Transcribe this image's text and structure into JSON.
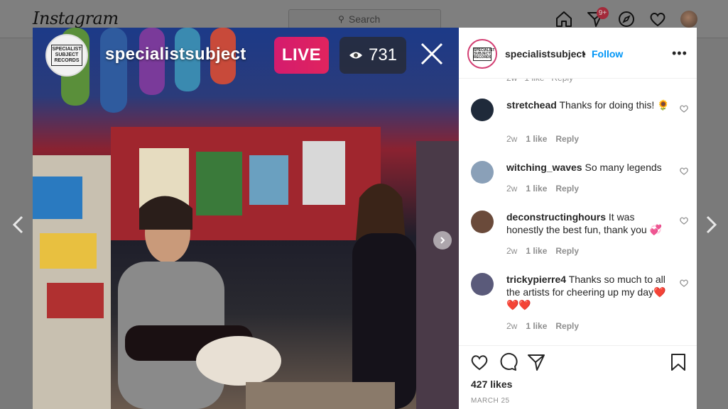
{
  "app": {
    "logo_text": "Instagram"
  },
  "search": {
    "placeholder": "Search"
  },
  "nav": {
    "icons": [
      "home-icon",
      "direct-icon",
      "explore-icon",
      "activity-heart-icon",
      "profile-avatar"
    ],
    "notification_badge": "9+"
  },
  "video": {
    "username": "specialistsubject",
    "live_label": "LIVE",
    "viewer_count": "731",
    "avatar_text": "SPECIALIST SUBJECT RECORDS"
  },
  "post": {
    "username": "specialistsubject",
    "separator": "•",
    "follow_label": "Follow",
    "more_label": "•••",
    "avatar_text": "SPECIALIST SUBJECT RECORDS",
    "likes": "427 likes",
    "date": "MARCH 25"
  },
  "comments": [
    {
      "username": "stretchead",
      "text": "Thanks for doing this! 🌻",
      "age": "2w",
      "likes": "1 like",
      "reply": "Reply",
      "avatar_color": "#1f2a3a"
    },
    {
      "username": "witching_waves",
      "text": "So many legends",
      "age": "2w",
      "likes": "1 like",
      "reply": "Reply",
      "avatar_color": "#8aa0b8"
    },
    {
      "username": "deconstructinghours",
      "text": "It was honestly the best fun, thank you 💞",
      "age": "2w",
      "likes": "1 like",
      "reply": "Reply",
      "avatar_color": "#6a4a3a"
    },
    {
      "username": "trickypierre4",
      "text": "Thanks so much to all the artists for cheering up my day❤️❤️❤️",
      "age": "2w",
      "likes": "1 like",
      "reply": "Reply",
      "avatar_color": "#5a5a7a"
    }
  ],
  "colors": {
    "accent": "#0095f6",
    "live": "#e0245e",
    "text": "#262626",
    "muted": "#8e8e8e"
  }
}
